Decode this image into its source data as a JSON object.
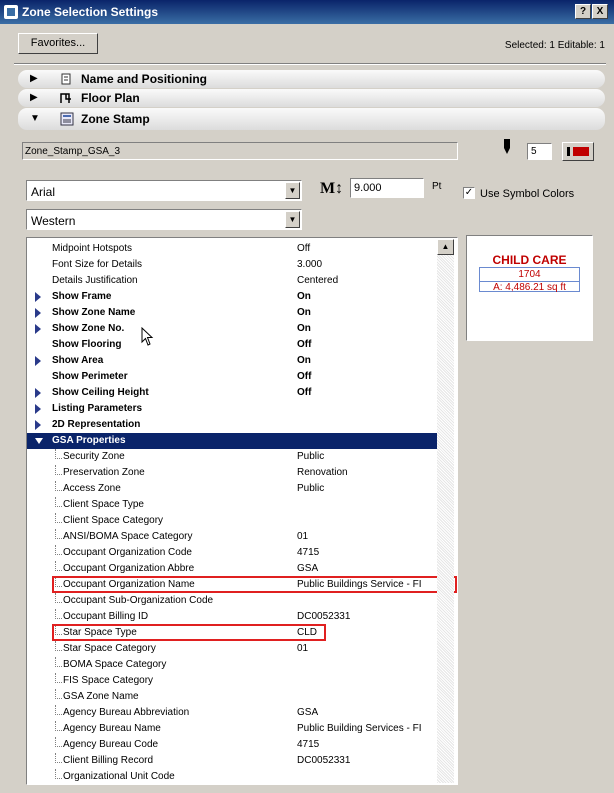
{
  "window": {
    "title": "Zone Selection Settings",
    "help_btn": "?",
    "close_btn": "X"
  },
  "toolbar": {
    "favorites_label": "Favorites...",
    "selected_info": "Selected: 1 Editable: 1"
  },
  "sections": [
    {
      "label": "Name and Positioning",
      "expanded": false,
      "icon": "name-position-icon"
    },
    {
      "label": "Floor Plan",
      "expanded": false,
      "icon": "floor-plan-icon"
    },
    {
      "label": "Zone Stamp",
      "expanded": true,
      "icon": "zone-stamp-icon"
    }
  ],
  "stamp": {
    "name": "Zone_Stamp_GSA_3",
    "pen_number": "5",
    "pen_color": "#c00000"
  },
  "font": {
    "family": "Arial",
    "size": "9.000",
    "unit": "Pt",
    "script": "Western",
    "size_icon": "M↕",
    "use_symbol_colors_label": "Use Symbol Colors",
    "use_symbol_colors_checked": true
  },
  "preview": {
    "zone_name": "CHILD CARE",
    "zone_number": "1704",
    "area": "A: 4,486.21 sq ft",
    "color": "#c00000"
  },
  "params": [
    {
      "name": "Midpoint Hotspots",
      "value": "Off"
    },
    {
      "name": "Font Size for Details",
      "value": "3.000"
    },
    {
      "name": "Details Justification",
      "value": "Centered"
    },
    {
      "name": "Show Frame",
      "value": "On",
      "bold": true,
      "expander": true
    },
    {
      "name": "Show Zone Name",
      "value": "On",
      "bold": true,
      "expander": true
    },
    {
      "name": "Show Zone No.",
      "value": "On",
      "bold": true,
      "expander": true
    },
    {
      "name": "Show Flooring",
      "value": "Off",
      "bold": true
    },
    {
      "name": "Show Area",
      "value": "On",
      "bold": true,
      "expander": true
    },
    {
      "name": "Show Perimeter",
      "value": "Off",
      "bold": true
    },
    {
      "name": "Show Ceiling Height",
      "value": "Off",
      "bold": true,
      "expander": true
    },
    {
      "name": "Listing Parameters",
      "value": "",
      "bold": true,
      "expander": true
    },
    {
      "name": "2D Representation",
      "value": "",
      "bold": true,
      "expander": true
    },
    {
      "name": "GSA Properties",
      "value": "",
      "bold": true,
      "highlighted": true
    },
    {
      "name": "Security Zone",
      "value": "Public",
      "child": true
    },
    {
      "name": "Preservation Zone",
      "value": "Renovation",
      "child": true
    },
    {
      "name": "Access Zone",
      "value": "Public",
      "child": true
    },
    {
      "name": "Client Space Type",
      "value": "",
      "child": true
    },
    {
      "name": "Client Space Category",
      "value": "",
      "child": true
    },
    {
      "name": "ANSI/BOMA Space Category",
      "value": "01",
      "child": true
    },
    {
      "name": "Occupant Organization Code",
      "value": "4715",
      "child": true
    },
    {
      "name": "Occupant Organization Abbre",
      "value": "GSA",
      "child": true
    },
    {
      "name": "Occupant Organization Name",
      "value": "Public Buildings Service - FI",
      "child": true,
      "boxed": true
    },
    {
      "name": "Occupant Sub-Organization Code",
      "value": "",
      "child": true
    },
    {
      "name": "Occupant Billing ID",
      "value": "DC0052331",
      "child": true
    },
    {
      "name": "Star Space Type",
      "value": "CLD",
      "child": true,
      "boxed": true
    },
    {
      "name": "Star Space Category",
      "value": "01",
      "child": true
    },
    {
      "name": "BOMA Space Category",
      "value": "",
      "child": true
    },
    {
      "name": "FIS Space Category",
      "value": "",
      "child": true
    },
    {
      "name": "GSA Zone Name",
      "value": "",
      "child": true
    },
    {
      "name": "Agency Bureau Abbreviation",
      "value": "GSA",
      "child": true
    },
    {
      "name": "Agency Bureau Name",
      "value": "Public Building Services - FI",
      "child": true
    },
    {
      "name": "Agency Bureau Code",
      "value": "4715",
      "child": true
    },
    {
      "name": "Client Billing Record",
      "value": "DC0052331",
      "child": true
    },
    {
      "name": "Organizational Unit Code",
      "value": "",
      "child": true
    }
  ]
}
